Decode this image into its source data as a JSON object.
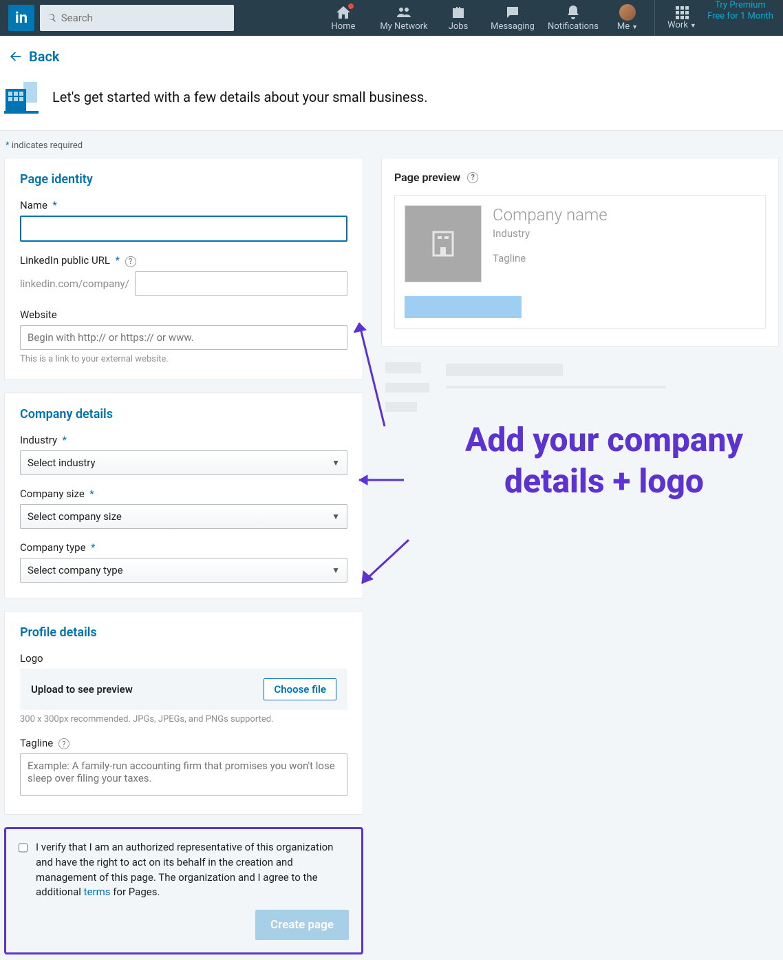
{
  "nav": {
    "search_placeholder": "Search",
    "home": "Home",
    "network": "My Network",
    "jobs": "Jobs",
    "messaging": "Messaging",
    "notifications": "Notifications",
    "me": "Me",
    "work": "Work",
    "premium_l1": "Try Premium",
    "premium_l2": "Free for 1 Month"
  },
  "back": "Back",
  "hero": "Let's get started with a few details about your small business.",
  "required_note": "indicates required",
  "identity": {
    "heading": "Page identity",
    "name_label": "Name",
    "url_label": "LinkedIn public URL",
    "url_prefix": "linkedin.com/company/",
    "website_label": "Website",
    "website_placeholder": "Begin with http:// or https:// or www.",
    "website_hint": "This is a link to your external website."
  },
  "company": {
    "heading": "Company details",
    "industry_label": "Industry",
    "industry_select": "Select industry",
    "size_label": "Company size",
    "size_select": "Select company size",
    "type_label": "Company type",
    "type_select": "Select company type"
  },
  "profile": {
    "heading": "Profile details",
    "logo_label": "Logo",
    "upload_text": "Upload to see preview",
    "choose_file": "Choose file",
    "logo_hint": "300 x 300px recommended. JPGs, JPEGs, and PNGs supported.",
    "tagline_label": "Tagline",
    "tagline_placeholder": "Example: A family-run accounting firm that promises you won't lose sleep over filing your taxes."
  },
  "verify": {
    "text_a": "I verify that I am an authorized representative of this organization and have the right to act on its behalf in the creation and management of this page. The organization and I agree to the additional ",
    "terms": "terms",
    "text_b": " for Pages.",
    "create": "Create page"
  },
  "preview": {
    "title": "Page preview",
    "name": "Company name",
    "industry": "Industry",
    "tagline": "Tagline"
  },
  "annotation": "Add your company details + logo"
}
